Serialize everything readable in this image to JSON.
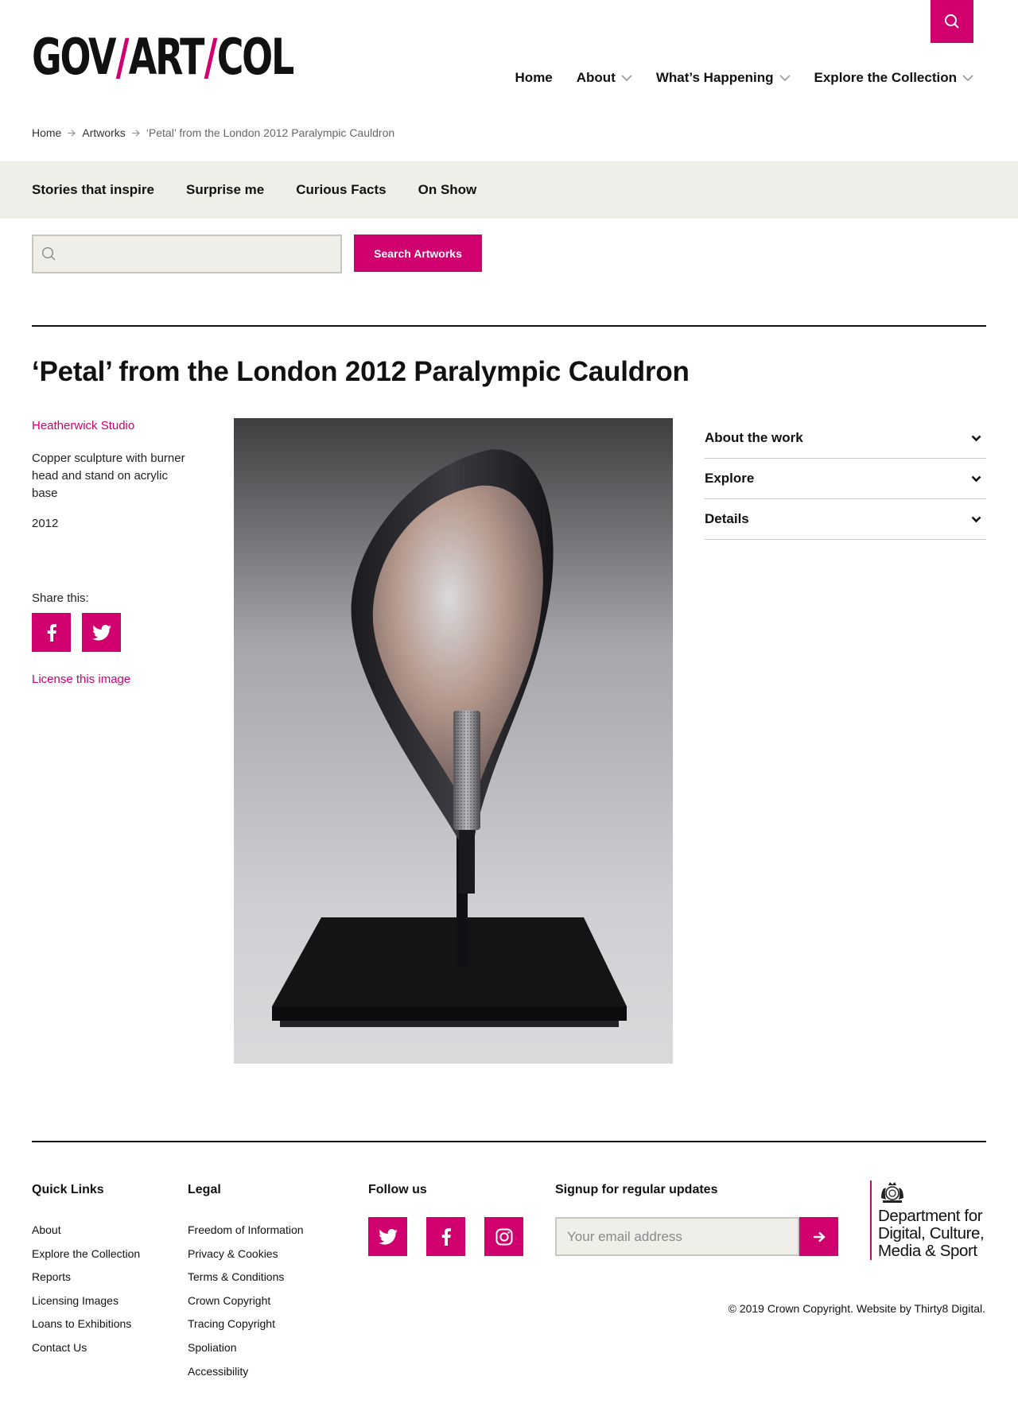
{
  "site": {
    "logo": {
      "part1": "GOV",
      "part2": "ART",
      "part3": "COL",
      "slash": "/"
    },
    "search_icon": "search-icon"
  },
  "nav": {
    "items": [
      {
        "label": "Home",
        "has_dropdown": false
      },
      {
        "label": "About",
        "has_dropdown": true
      },
      {
        "label": "What’s Happening",
        "has_dropdown": true
      },
      {
        "label": "Explore the Collection",
        "has_dropdown": true
      }
    ]
  },
  "breadcrumb": {
    "items": [
      "Home",
      "Artworks",
      "‘Petal’ from the London 2012 Paralympic Cauldron"
    ]
  },
  "subnav": {
    "items": [
      "Stories that inspire",
      "Surprise me",
      "Curious Facts",
      "On Show"
    ]
  },
  "search": {
    "placeholder": "",
    "value": "",
    "button_label": "Search Artworks"
  },
  "artwork": {
    "title": "‘Petal’ from the London 2012 Paralympic Cauldron",
    "artist": "Heatherwick Studio",
    "medium": "Copper sculpture with burner head and stand on acrylic base",
    "year": "2012",
    "share_label": "Share this:",
    "license_label": "License this image"
  },
  "accordion": {
    "items": [
      "About the work",
      "Explore",
      "Details"
    ]
  },
  "footer": {
    "quick_links": {
      "heading": "Quick Links",
      "items": [
        "About",
        "Explore the Collection",
        "Reports",
        "Licensing Images",
        "Loans to Exhibitions",
        "Contact Us"
      ]
    },
    "legal": {
      "heading": "Legal",
      "items": [
        "Freedom of Information",
        "Privacy & Cookies",
        "Terms & Conditions",
        "Crown Copyright",
        "Tracing Copyright",
        "Spoliation",
        "Accessibility"
      ]
    },
    "follow": {
      "heading": "Follow us",
      "icons": [
        "twitter-icon",
        "facebook-icon",
        "instagram-icon"
      ]
    },
    "signup": {
      "heading": "Signup for regular updates",
      "placeholder": "Your email address"
    },
    "dcms": {
      "line1": "Department for",
      "line2": "Digital, Culture,",
      "line3": "Media & Sport"
    },
    "copyright": "© 2019 Crown Copyright. Website by Thirty8 Digital."
  },
  "colors": {
    "accent": "#d0006f",
    "subnav_bg": "#efeee9",
    "text": "#111111"
  }
}
